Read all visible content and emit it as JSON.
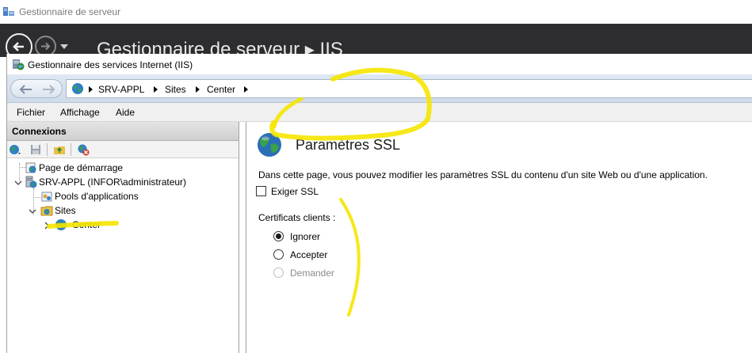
{
  "server_manager": {
    "window_title": "Gestionnaire de serveur",
    "breadcrumb": "Gestionnaire de serveur ▸ IIS"
  },
  "iis": {
    "window_title": "Gestionnaire des services Internet (IIS)",
    "address_path": [
      "SRV-APPL",
      "Sites",
      "Center"
    ],
    "menu": [
      "Fichier",
      "Affichage",
      "Aide"
    ],
    "connections": {
      "header": "Connexions",
      "tree": [
        {
          "label": "Page de démarrage",
          "icon": "start-page-icon"
        },
        {
          "label": "SRV-APPL (INFOR\\administrateur)",
          "icon": "server-icon",
          "expanded": true
        },
        {
          "label": "Pools d'applications",
          "icon": "app-pools-icon"
        },
        {
          "label": "Sites",
          "icon": "sites-folder-icon",
          "expanded": true
        },
        {
          "label": "Center",
          "icon": "globe-icon",
          "selected": true
        }
      ]
    },
    "ssl_page": {
      "title": "Paramètres SSL",
      "description": "Dans cette page, vous pouvez modifier les paramètres SSL du contenu d'un site Web ou d'une application.",
      "require_ssl_label": "Exiger SSL",
      "require_ssl_checked": false,
      "client_certs_label": "Certificats clients :",
      "options": [
        {
          "label": "Ignorer",
          "checked": true,
          "enabled": true
        },
        {
          "label": "Accepter",
          "checked": false,
          "enabled": true
        },
        {
          "label": "Demander",
          "checked": false,
          "enabled": false
        }
      ]
    }
  },
  "colors": {
    "sm_header": "#2d2d30",
    "annotation": "#f5e600",
    "address_bar": "#dfe8f3"
  }
}
